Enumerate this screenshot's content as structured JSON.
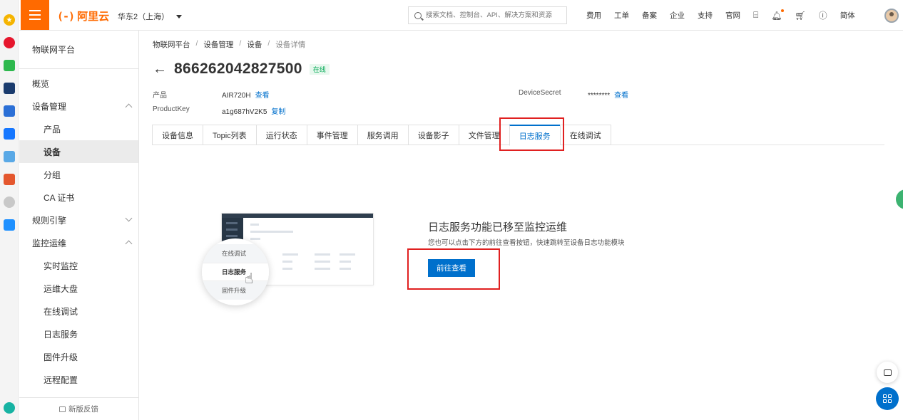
{
  "topbar": {
    "logo_text": "阿里云",
    "logo_bracket": "(-)",
    "region": "华东2（上海）",
    "search_placeholder": "搜索文档、控制台、API、解决方案和资源",
    "nav": [
      "费用",
      "工单",
      "备案",
      "企业",
      "支持",
      "官网"
    ],
    "lang": "简体"
  },
  "sidebar": {
    "title": "物联网平台",
    "items": [
      {
        "label": "概览"
      },
      {
        "label": "设备管理"
      },
      {
        "label": "产品"
      },
      {
        "label": "设备"
      },
      {
        "label": "分组"
      },
      {
        "label": "CA 证书"
      },
      {
        "label": "规则引擎"
      },
      {
        "label": "监控运维"
      },
      {
        "label": "实时监控"
      },
      {
        "label": "运维大盘"
      },
      {
        "label": "在线调试"
      },
      {
        "label": "日志服务"
      },
      {
        "label": "固件升级"
      },
      {
        "label": "远程配置"
      }
    ],
    "footer": "新版反馈"
  },
  "breadcrumb": [
    "物联网平台",
    "设备管理",
    "设备",
    "设备详情"
  ],
  "device": {
    "name": "866262042827500",
    "status": "在线",
    "product_label": "产品",
    "product_value": "AIR720H",
    "view_label": "查看",
    "productkey_label": "ProductKey",
    "productkey_value": "a1g687hV2K5",
    "copy_label": "复制",
    "secret_label": "DeviceSecret",
    "secret_value": "********",
    "secret_view": "查看"
  },
  "tabs": [
    "设备信息",
    "Topic列表",
    "运行状态",
    "事件管理",
    "服务调用",
    "设备影子",
    "文件管理",
    "日志服务",
    "在线调试"
  ],
  "active_tab": "日志服务",
  "illustration": {
    "menu": [
      "在线调试",
      "日志服务",
      "固件升级"
    ]
  },
  "notice": {
    "title": "日志服务功能已移至监控运维",
    "subtitle": "您也可以点击下方的前往查看按钮，快速跳转至设备日志功能模块",
    "button": "前往查看"
  },
  "colors": {
    "brand": "#ff6a00",
    "accent": "#0070cc",
    "highlight": "#e02020",
    "online": "#00a854"
  }
}
